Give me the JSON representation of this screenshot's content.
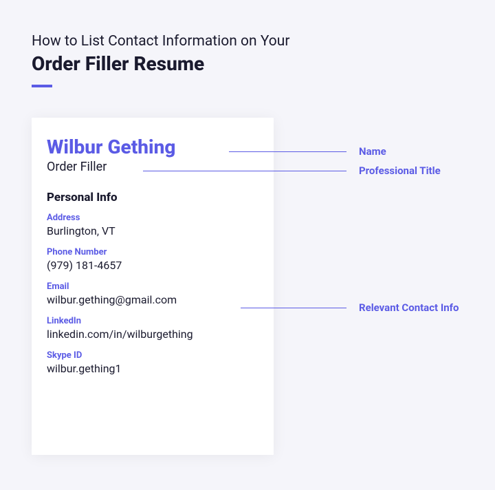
{
  "header": {
    "subtitle": "How to List Contact Information on Your",
    "title": "Order Filler Resume"
  },
  "resume": {
    "name": "Wilbur Gething",
    "title": "Order Filler",
    "section_heading": "Personal Info",
    "fields": {
      "address_label": "Address",
      "address_value": "Burlington, VT",
      "phone_label": "Phone Number",
      "phone_value": "(979) 181-4657",
      "email_label": "Email",
      "email_value": "wilbur.gething@gmail.com",
      "linkedin_label": "LinkedIn",
      "linkedin_value": "linkedin.com/in/wilburgething",
      "skype_label": "Skype ID",
      "skype_value": "wilbur.gething1"
    }
  },
  "annotations": {
    "name": "Name",
    "title": "Professional Title",
    "contact": "Relevant Contact Info"
  }
}
